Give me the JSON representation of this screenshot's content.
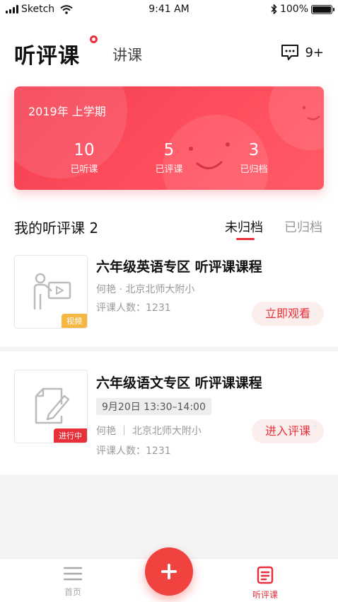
{
  "status_bar": {
    "carrier": "Sketch",
    "time": "9:41 AM",
    "battery": "100%"
  },
  "header": {
    "title": "听评课",
    "second_tab": "讲课",
    "message_count": "9+"
  },
  "summary_card": {
    "term": "2019年 上学期",
    "stats": [
      {
        "value": "10",
        "label": "已听课"
      },
      {
        "value": "5",
        "label": "已评课"
      },
      {
        "value": "3",
        "label": "已归档"
      }
    ]
  },
  "section": {
    "title": "我的听评课 2",
    "tabs": [
      "未归档",
      "已归档"
    ],
    "active_tab": "未归档"
  },
  "items": [
    {
      "title": "六年级英语专区 听评课课程",
      "teacher_school": "何艳 · 北京北师大附小",
      "reviewers": "评课人数：1231",
      "tag": "视频",
      "action": "立即观看"
    },
    {
      "title": "六年级语文专区 听评课课程",
      "time": "9月20日 13:30–14:00",
      "teacher_school": "何艳 ｜ 北京北师大附小",
      "reviewers": "评课人数：1231",
      "tag": "进行中",
      "action": "进入评课"
    }
  ],
  "tab_bar": {
    "home": "首页",
    "course": "听评课",
    "active": "听评课"
  },
  "colors": {
    "accent": "#e8303b",
    "card": "#f43f52",
    "video_tag": "#f5b742"
  },
  "icons": [
    "signal-icon",
    "wifi-icon",
    "bluetooth-icon",
    "battery-icon",
    "message-icon",
    "lecture-icon",
    "edit-doc-icon",
    "menu-icon",
    "add-icon",
    "course-icon"
  ]
}
